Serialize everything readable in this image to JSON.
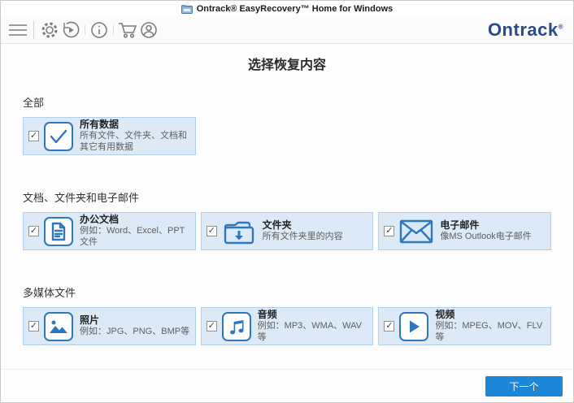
{
  "window": {
    "title": "Ontrack® EasyRecovery™ Home for Windows"
  },
  "toolbar": {
    "logo": "Ontrack",
    "logo_mark": "®",
    "icons": [
      "menu-icon",
      "settings-gear-icon",
      "resume-recovery-icon",
      "info-icon",
      "shop-cart-icon",
      "account-icon"
    ]
  },
  "page": {
    "heading": "选择恢复内容"
  },
  "sections": [
    {
      "label": "全部",
      "cards": [
        {
          "title": "所有数据",
          "desc": "所有文件、文件夹、文档和其它有用数据",
          "icon": "all-data-check-icon",
          "checked": true
        }
      ]
    },
    {
      "label": "文档、文件夹和电子邮件",
      "cards": [
        {
          "title": "办公文档",
          "desc": "例如：Word、Excel、PPT文件",
          "icon": "office-document-icon",
          "checked": true
        },
        {
          "title": "文件夹",
          "desc": "所有文件夹里的内容",
          "icon": "folder-icon",
          "checked": true
        },
        {
          "title": "电子邮件",
          "desc": "像MS Outlook电子邮件",
          "icon": "email-icon",
          "checked": true
        }
      ]
    },
    {
      "label": "多媒体文件",
      "cards": [
        {
          "title": "照片",
          "desc": "例如：JPG、PNG、BMP等",
          "icon": "photo-icon",
          "checked": true
        },
        {
          "title": "音频",
          "desc": "例如：MP3、WMA、WAV等",
          "icon": "audio-icon",
          "checked": true
        },
        {
          "title": "视频",
          "desc": "例如：MPEG、MOV、FLV等",
          "icon": "video-icon",
          "checked": true
        }
      ]
    }
  ],
  "footer": {
    "next_label": "下一个"
  },
  "checkbox_glyph": "✓",
  "colors": {
    "accent_blue": "#1c86d8",
    "icon_blue": "#2e77bd",
    "card_bg": "#dceaf7",
    "card_border": "#b3cfe9",
    "logo_navy": "#2a4a88"
  }
}
